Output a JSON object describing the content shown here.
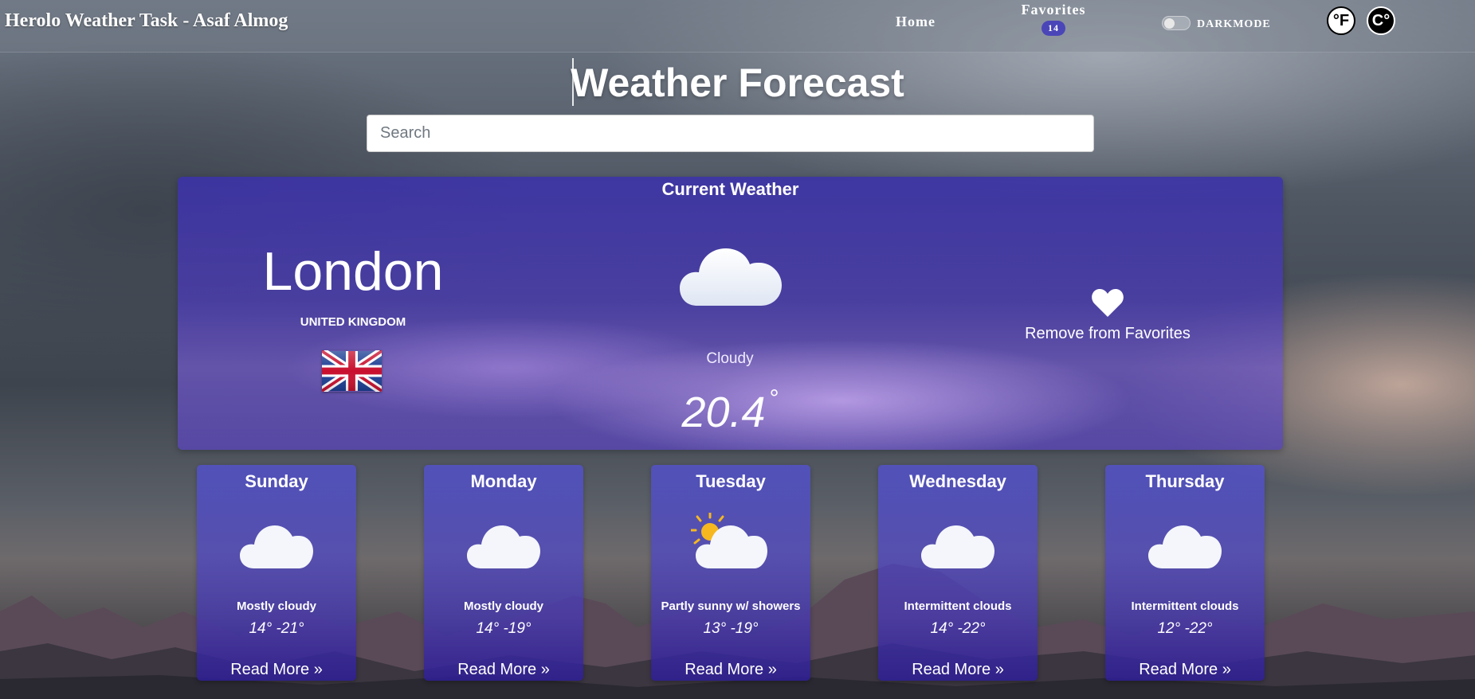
{
  "header": {
    "brand": "Herolo Weather Task - Asaf Almog",
    "nav": {
      "home": "Home",
      "favorites": "Favorites",
      "favorites_count": "14"
    },
    "darkmode_label": "DARKMODE",
    "unit_f": "°F",
    "unit_c": "C°"
  },
  "page": {
    "title": "Weather Forecast",
    "search_placeholder": "Search"
  },
  "current": {
    "heading": "Current Weather",
    "city": "London",
    "country": "UNITED KINGDOM",
    "flag_icon": "uk-flag-icon",
    "weather_icon": "cloud-icon",
    "condition": "Cloudy",
    "temperature": "20.4",
    "degree": "°",
    "favorite_action": "Remove from Favorites",
    "favorite_icon": "heart-icon"
  },
  "forecast": [
    {
      "day": "Sunday",
      "icon": "cloud-icon",
      "desc": "Mostly cloudy",
      "temp": "14° -21°",
      "more": "Read More"
    },
    {
      "day": "Monday",
      "icon": "cloud-icon",
      "desc": "Mostly cloudy",
      "temp": "14° -19°",
      "more": "Read More"
    },
    {
      "day": "Tuesday",
      "icon": "partly-sunny-icon",
      "desc": "Partly sunny w/ showers",
      "temp": "13° -19°",
      "more": "Read More"
    },
    {
      "day": "Wednesday",
      "icon": "cloud-icon",
      "desc": "Intermittent clouds",
      "temp": "14° -22°",
      "more": "Read More"
    },
    {
      "day": "Thursday",
      "icon": "cloud-icon",
      "desc": "Intermittent clouds",
      "temp": "12° -22°",
      "more": "Read More"
    }
  ],
  "colors": {
    "panel": "#4a3cae",
    "badge": "#4a46b8",
    "cloud": "#f4f6fb",
    "sun": "#f6b81e"
  }
}
